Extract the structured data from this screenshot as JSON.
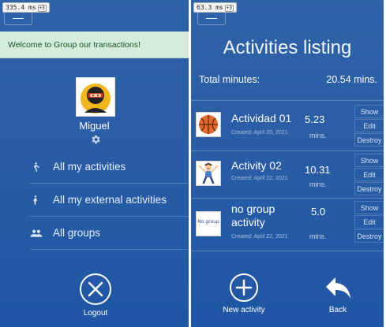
{
  "left": {
    "debug_badge": {
      "text": "335.4 ms",
      "tag": "+3"
    },
    "flash_message": "Welcome to Group our transactions!",
    "user": {
      "name": "Miguel"
    },
    "nav": [
      {
        "label": "All my activities",
        "icon": "person-walking-icon"
      },
      {
        "label": "All my external activities",
        "icon": "person-walking-icon"
      },
      {
        "label": "All groups",
        "icon": "group-icon"
      }
    ],
    "logout_label": "Logout"
  },
  "right": {
    "debug_badge": {
      "text": "63.3 ms",
      "tag": "+3"
    },
    "title": "Activities listing",
    "total_label": "Total minutes:",
    "total_value": "20.54 mins.",
    "activities": [
      {
        "name": "Actividad 01",
        "created": "Created: April 20, 2021",
        "minutes": "5.23",
        "minutes_label": "mins.",
        "thumb": "basketball-icon",
        "actions": [
          "Show",
          "Edit",
          "Destroy"
        ]
      },
      {
        "name": "Activity 02",
        "created": "Created: April 22, 2021",
        "minutes": "10.31",
        "minutes_label": "mins.",
        "thumb": "exercise-person-icon",
        "actions": [
          "Show",
          "Edit",
          "Destroy"
        ]
      },
      {
        "name": "no group activity",
        "created": "Created: April 22, 2021",
        "minutes": "5.0",
        "minutes_label": "mins.",
        "thumb": "no-group-image",
        "thumb_text": "No group",
        "actions": [
          "Show",
          "Edit",
          "Destroy"
        ]
      }
    ],
    "new_activity_label": "New activity",
    "back_label": "Back"
  },
  "colors": {
    "panel_blue": "#2a5da5",
    "flash_bg": "#d4ecd9",
    "flash_text": "#155724"
  }
}
